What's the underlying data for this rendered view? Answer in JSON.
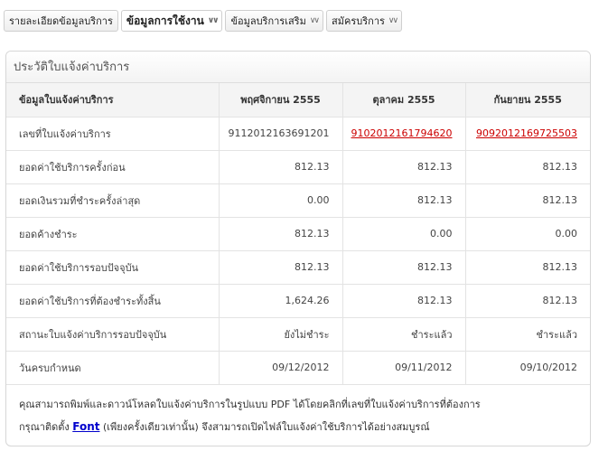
{
  "tabs": [
    {
      "label": "รายละเอียดข้อมูลบริการ",
      "active": false,
      "chevron": ""
    },
    {
      "label": "ข้อมูลการใช้งาน",
      "active": true,
      "chevron": "»"
    },
    {
      "label": "ข้อมูลบริการเสริม",
      "active": false,
      "chevron": "»"
    },
    {
      "label": "สมัครบริการ",
      "active": false,
      "chevron": "»"
    }
  ],
  "panel": {
    "title": "ประวัติใบแจ้งค่าบริการ",
    "table": {
      "headers": [
        "ข้อมูลใบแจ้งค่าบริการ",
        "พฤศจิกายน 2555",
        "ตุลาคม 2555",
        "กันยายน 2555"
      ],
      "rows": [
        {
          "label": "เลขที่ใบแจ้งค่าบริการ",
          "values": [
            "9112012163691201",
            "9102012161794620",
            "9092012169725503"
          ],
          "links": [
            false,
            true,
            true
          ]
        },
        {
          "label": "ยอดค่าใช้บริการครั้งก่อน",
          "values": [
            "812.13",
            "812.13",
            "812.13"
          ]
        },
        {
          "label": "ยอดเงินรวมที่ชำระครั้งล่าสุด",
          "values": [
            "0.00",
            "812.13",
            "812.13"
          ]
        },
        {
          "label": "ยอดค้างชำระ",
          "values": [
            "812.13",
            "0.00",
            "0.00"
          ]
        },
        {
          "label": "ยอดค่าใช้บริการรอบปัจจุบัน",
          "values": [
            "812.13",
            "812.13",
            "812.13"
          ]
        },
        {
          "label": "ยอดค่าใช้บริการที่ต้องชำระทั้งสิ้น",
          "values": [
            "1,624.26",
            "812.13",
            "812.13"
          ]
        },
        {
          "label": "สถานะใบแจ้งค่าบริการรอบปัจจุบัน",
          "values": [
            "ยังไม่ชำระ",
            "ชำระแล้ว",
            "ชำระแล้ว"
          ]
        },
        {
          "label": "วันครบกำหนด",
          "values": [
            "09/12/2012",
            "09/11/2012",
            "09/10/2012"
          ]
        }
      ]
    },
    "footnote": {
      "line1": "คุณสามารถพิมพ์และดาวน์โหลดใบแจ้งค่าบริการในรูปแบบ PDF ได้โดยคลิกที่เลขที่ใบแจ้งค่าบริการที่ต้องการ",
      "line2_before": "กรุณาติดตั้ง ",
      "font_link": "Font",
      "line2_after": " (เพียงครั้งเดียวเท่านั้น) จึงสามารถเปิดไฟล์ใบแจ้งค่าใช้บริการได้อย่างสมบูรณ์"
    }
  }
}
